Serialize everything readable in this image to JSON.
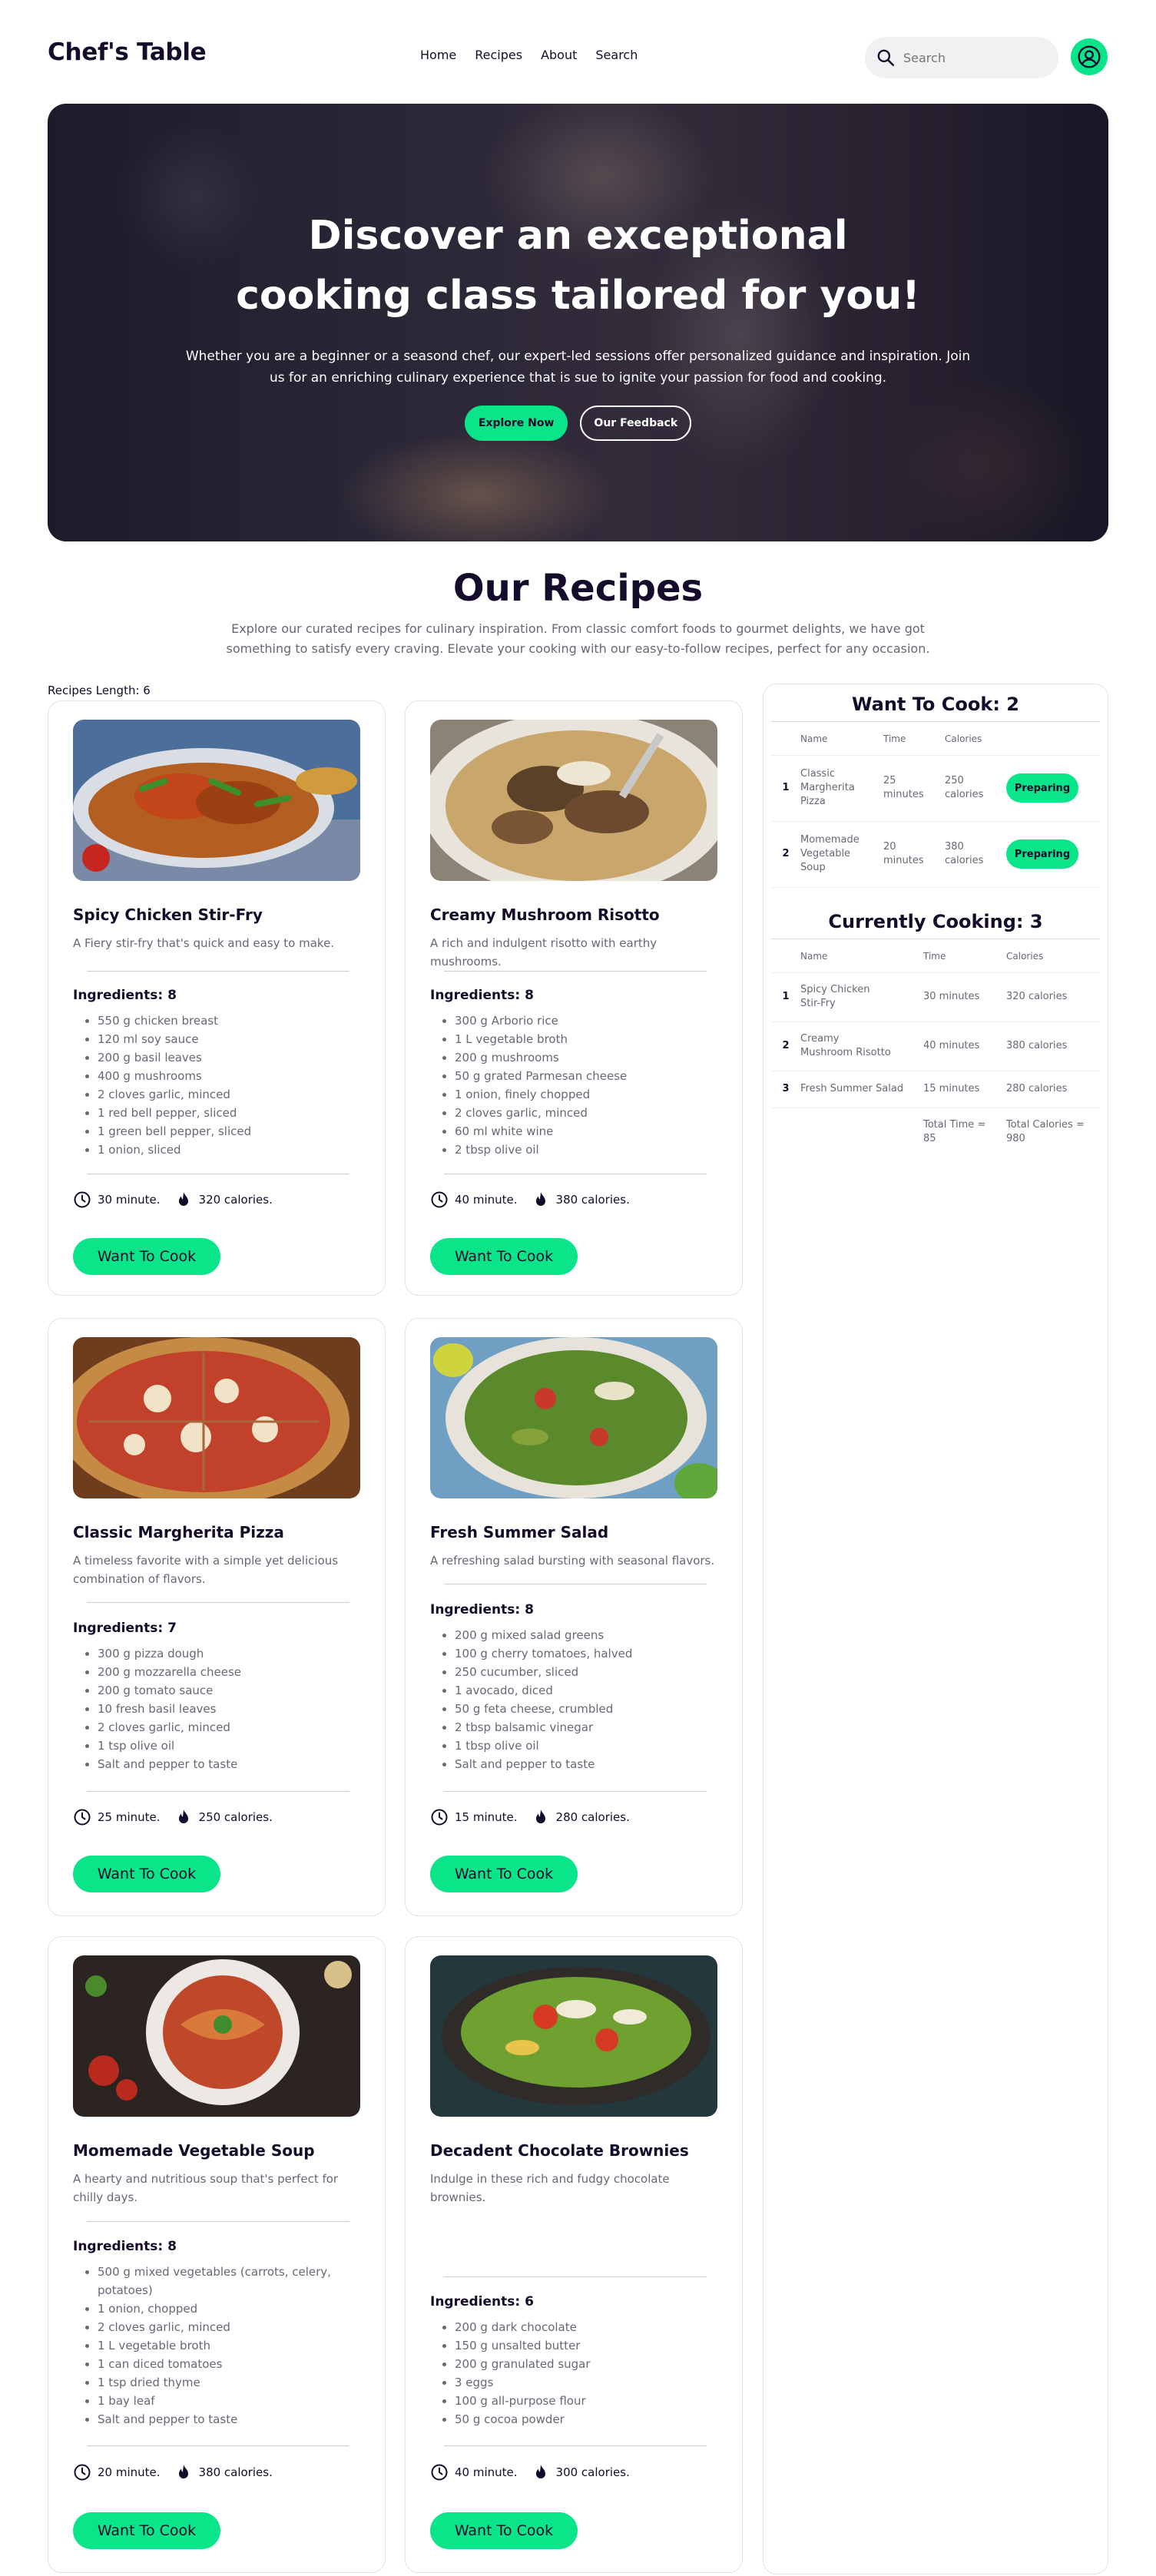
{
  "nav": {
    "logo": "Chef's Table",
    "links": [
      "Home",
      "Recipes",
      "About",
      "Search"
    ],
    "search_placeholder": "Search"
  },
  "hero": {
    "title": "Discover an exceptional cooking class tailored for you!",
    "description": "Whether you are a beginner or a seasond chef, our expert-led sessions offer personalized guidance and inspiration. Join us for an enriching culinary experience that is sue to ignite your passion for food and cooking.",
    "primary_button": "Explore Now",
    "secondary_button": "Our Feedback"
  },
  "recipes_section": {
    "title": "Our Recipes",
    "description": "Explore our curated recipes for culinary inspiration. From classic comfort foods to gourmet delights, we have got something to satisfy every craving. Elevate your cooking with our easy-to-follow recipes, perfect for any occasion.",
    "length_label": "Recipes Length: 6"
  },
  "recipes": [
    {
      "name": "Spicy Chicken Stir-Fry",
      "description": "A Fiery stir-fry that's quick and easy to make.",
      "ingredients_title": "Ingredients: 8",
      "ingredients": [
        "550 g chicken breast",
        "120 ml soy sauce",
        "200 g basil leaves",
        "400 g mushrooms",
        "2 cloves garlic, minced",
        "1 red bell pepper, sliced",
        "1 green bell pepper, sliced",
        "1 onion, sliced"
      ],
      "time": "30 minute.",
      "calories": "320 calories.",
      "button": "Want To Cook"
    },
    {
      "name": "Creamy Mushroom Risotto",
      "description": "A rich and indulgent risotto with earthy mushrooms.",
      "ingredients_title": "Ingredients: 8",
      "ingredients": [
        "300 g Arborio rice",
        "1 L vegetable broth",
        "200 g mushrooms",
        "50 g grated Parmesan cheese",
        "1 onion, finely chopped",
        "2 cloves garlic, minced",
        "60 ml white wine",
        "2 tbsp olive oil"
      ],
      "time": "40 minute.",
      "calories": "380 calories.",
      "button": "Want To Cook"
    },
    {
      "name": "Classic Margherita Pizza",
      "description": "A timeless favorite with a simple yet delicious combination of flavors.",
      "ingredients_title": "Ingredients: 7",
      "ingredients": [
        "300 g pizza dough",
        "200 g mozzarella cheese",
        "200 g tomato sauce",
        "10 fresh basil leaves",
        "2 cloves garlic, minced",
        "1 tsp olive oil",
        "Salt and pepper to taste"
      ],
      "time": "25 minute.",
      "calories": "250 calories.",
      "button": "Want To Cook"
    },
    {
      "name": "Fresh Summer Salad",
      "description": "A refreshing salad bursting with seasonal flavors.",
      "ingredients_title": "Ingredients: 8",
      "ingredients": [
        "200 g mixed salad greens",
        "100 g cherry tomatoes, halved",
        "250 cucumber, sliced",
        "1 avocado, diced",
        "50 g feta cheese, crumbled",
        "2 tbsp balsamic vinegar",
        "1 tbsp olive oil",
        "Salt and pepper to taste"
      ],
      "time": "15 minute.",
      "calories": "280 calories.",
      "button": "Want To Cook"
    },
    {
      "name": "Momemade Vegetable Soup",
      "description": "A hearty and nutritious soup that's perfect for chilly days.",
      "ingredients_title": "Ingredients: 8",
      "ingredients": [
        "500 g mixed vegetables (carrots, celery, potatoes)",
        "1 onion, chopped",
        "2 cloves garlic, minced",
        "1 L vegetable broth",
        "1 can diced tomatoes",
        "1 tsp dried thyme",
        "1 bay leaf",
        "Salt and pepper to taste"
      ],
      "time": "20 minute.",
      "calories": "380 calories.",
      "button": "Want To Cook"
    },
    {
      "name": "Decadent Chocolate Brownies",
      "description": "Indulge in these rich and fudgy chocolate brownies.",
      "ingredients_title": "Ingredients: 6",
      "ingredients": [
        "200 g dark chocolate",
        "150 g unsalted butter",
        "200 g granulated sugar",
        "3 eggs",
        "100 g all-purpose flour",
        "50 g cocoa powder"
      ],
      "time": "40 minute.",
      "calories": "300 calories.",
      "button": "Want To Cook"
    }
  ],
  "sidebar": {
    "want_title": "Want To Cook: 2",
    "want_headers": [
      "Name",
      "Time",
      "Calories"
    ],
    "want_rows": [
      {
        "num": "1",
        "name": "Classic Margherita Pizza",
        "time": "25 minutes",
        "calories": "250 calories",
        "button": "Preparing"
      },
      {
        "num": "2",
        "name": "Momemade Vegetable Soup",
        "time": "20 minutes",
        "calories": "380 calories",
        "button": "Preparing"
      }
    ],
    "cooking_title": "Currently Cooking: 3",
    "cooking_headers": [
      "Name",
      "Time",
      "Calories"
    ],
    "cooking_rows": [
      {
        "num": "1",
        "name": "Spicy Chicken Stir-Fry",
        "time": "30 minutes",
        "calories": "320 calories"
      },
      {
        "num": "2",
        "name": "Creamy Mushroom Risotto",
        "time": "40 minutes",
        "calories": "380 calories"
      },
      {
        "num": "3",
        "name": "Fresh Summer Salad",
        "time": "15 minutes",
        "calories": "280 calories"
      }
    ],
    "total_time": "Total Time = 85",
    "total_calories": "Total Calories = 980"
  },
  "colors": {
    "accent": "#0be58a",
    "text": "#150b2b",
    "muted": "#6b6575"
  }
}
